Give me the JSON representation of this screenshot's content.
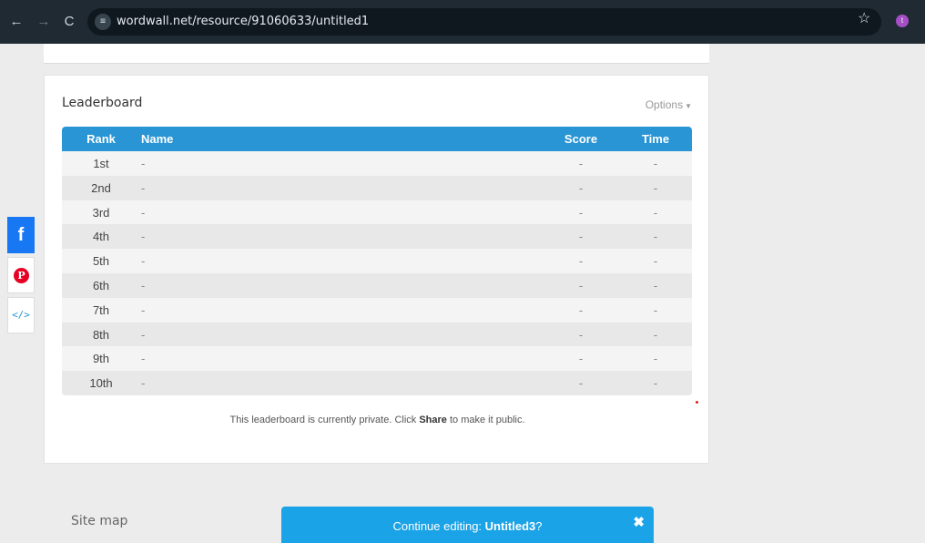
{
  "browser": {
    "url": "wordwall.net/resource/91060633/untitled1",
    "profile_initial": "t",
    "colors": {
      "toolbar": "#1f2a33",
      "profile": "#a54fc4"
    }
  },
  "leaderboard": {
    "title": "Leaderboard",
    "options_label": "Options",
    "headers": {
      "rank": "Rank",
      "name": "Name",
      "score": "Score",
      "time": "Time"
    },
    "rows": [
      {
        "rank": "1st",
        "name": "-",
        "score": "-",
        "time": "-"
      },
      {
        "rank": "2nd",
        "name": "-",
        "score": "-",
        "time": "-"
      },
      {
        "rank": "3rd",
        "name": "-",
        "score": "-",
        "time": "-"
      },
      {
        "rank": "4th",
        "name": "-",
        "score": "-",
        "time": "-"
      },
      {
        "rank": "5th",
        "name": "-",
        "score": "-",
        "time": "-"
      },
      {
        "rank": "6th",
        "name": "-",
        "score": "-",
        "time": "-"
      },
      {
        "rank": "7th",
        "name": "-",
        "score": "-",
        "time": "-"
      },
      {
        "rank": "8th",
        "name": "-",
        "score": "-",
        "time": "-"
      },
      {
        "rank": "9th",
        "name": "-",
        "score": "-",
        "time": "-"
      },
      {
        "rank": "10th",
        "name": "-",
        "score": "-",
        "time": "-"
      }
    ],
    "note_before": "This leaderboard is currently private. Click ",
    "note_bold": "Share",
    "note_after": " to make it public.",
    "colors": {
      "header": "#2a95d4"
    }
  },
  "share": {
    "facebook_glyph": "f",
    "pinterest_glyph": "P",
    "embed_glyph": "</>"
  },
  "footer": {
    "site_map": "Site map",
    "continue_prefix": "Continue editing: ",
    "continue_title": "Untitled3",
    "continue_suffix": "?",
    "close_glyph": "✖",
    "colors": {
      "continue_bar": "#1aa3e6"
    }
  }
}
